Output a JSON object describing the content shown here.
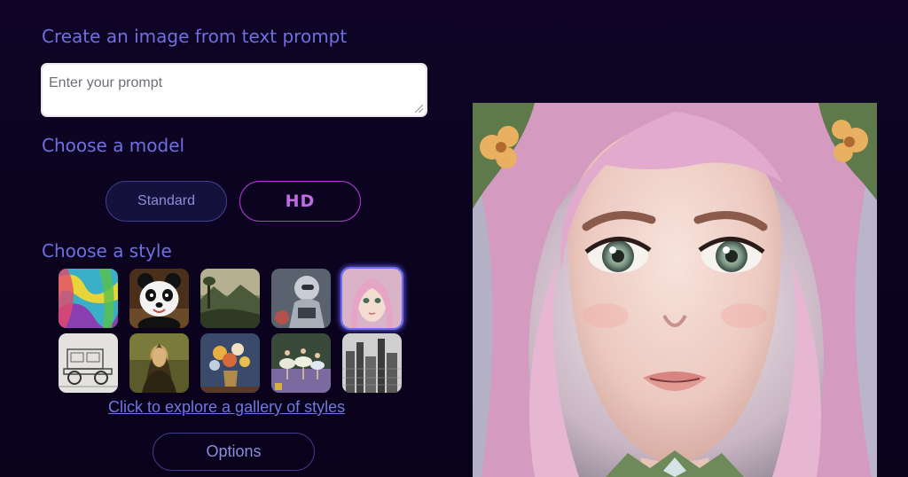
{
  "headings": {
    "create": "Create an image from text prompt",
    "model": "Choose a model",
    "style": "Choose a style"
  },
  "prompt": {
    "placeholder": "Enter your prompt",
    "value": ""
  },
  "models": {
    "standard": "Standard",
    "hd": "HD",
    "selected": "Standard"
  },
  "styles": {
    "items": [
      "abstract-paint-style",
      "panda-3d-style",
      "landscape-painting-style",
      "robot-scifi-style",
      "anime-portrait-style",
      "pencil-sketch-car-style",
      "renaissance-portrait-style",
      "flower-still-life-style",
      "ballet-dancers-style",
      "ink-city-style"
    ],
    "selected": "anime-portrait-style",
    "gallery_link": "Click to explore a gallery of styles"
  },
  "options_label": "Options",
  "preview": {
    "subject": "fantasy-portrait-image"
  },
  "colors": {
    "background": "#0c0320",
    "heading": "#6f6fe0",
    "accent_hd": "#b13ed3",
    "button_border": "#3e3f8e",
    "selected_glow": "#5a55e8"
  }
}
